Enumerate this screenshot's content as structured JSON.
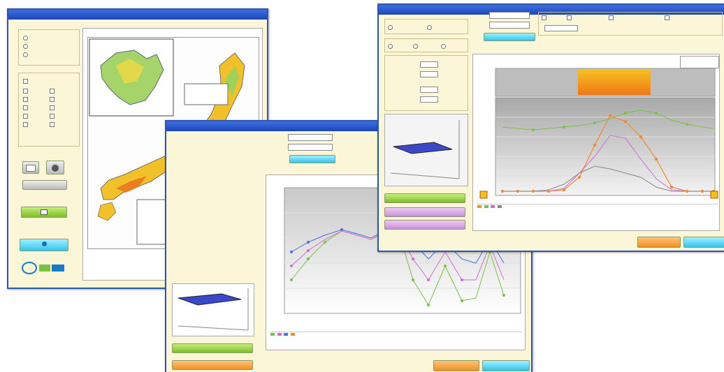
{
  "colors": {
    "title_bar": "#2f55b3",
    "window_bg": "#fbf6d8",
    "button_green": "#8cc63f",
    "button_cyan": "#33c3ee",
    "button_purple": "#d9a6e6",
    "button_orange": "#f39a2b",
    "series": [
      "#4a6fe0",
      "#d06ad6",
      "#f08a33",
      "#7ac043",
      "#333399",
      "#888888"
    ]
  },
  "icons": {
    "map": "japan-map-icon",
    "window": "window-icon",
    "surface": "3d-surface-icon"
  }
}
